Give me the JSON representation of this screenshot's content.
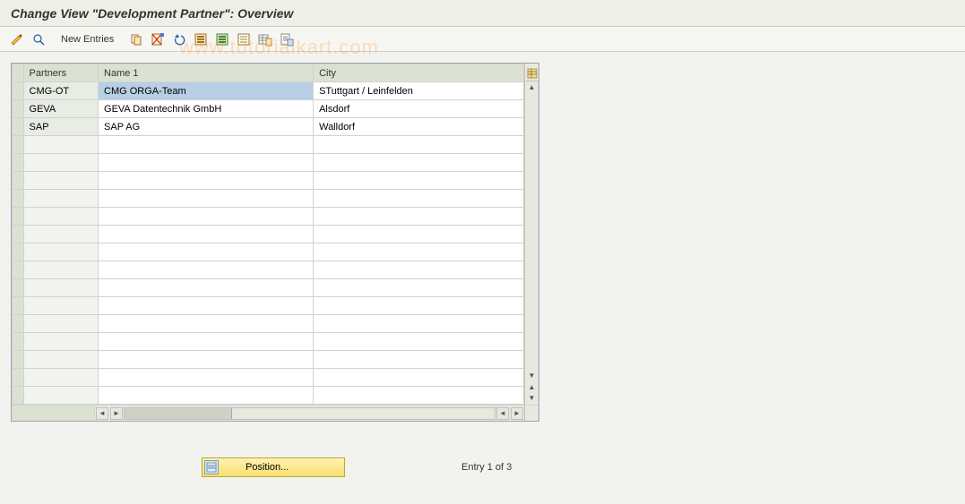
{
  "title": "Change View \"Development Partner\": Overview",
  "watermark": "www.tutorialkart.com",
  "toolbar": {
    "new_entries_label": "New Entries"
  },
  "table": {
    "columns": {
      "partners": "Partners",
      "name": "Name 1",
      "city": "City"
    },
    "rows": [
      {
        "partner": "CMG-OT",
        "name": "CMG ORGA-Team",
        "city": "STuttgart / Leinfelden",
        "selected_name": true
      },
      {
        "partner": "GEVA",
        "name": "GEVA Datentechnik GmbH",
        "city": "Alsdorf",
        "selected_name": false
      },
      {
        "partner": "SAP",
        "name": "SAP AG",
        "city": "Walldorf",
        "selected_name": false
      }
    ]
  },
  "footer": {
    "position_label": "Position...",
    "entry_status": "Entry 1 of 3"
  }
}
